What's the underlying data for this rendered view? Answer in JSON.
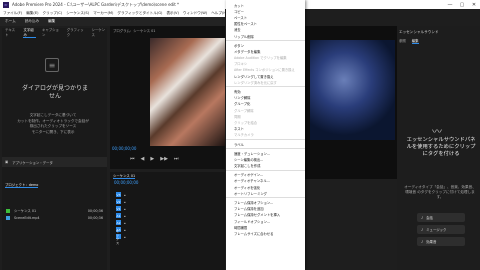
{
  "title_bar": {
    "app_logo": "Pr",
    "title": "Adobe Premiere Pro 2024 - C:\\ユーザー\\ALPC Garden\\デスクトップ\\demo\\scene edit *"
  },
  "window_controls": {
    "minimize": "—",
    "maximize": "▢",
    "close": "✕"
  },
  "menus": [
    "ファイル(F)",
    "編集(E)",
    "クリップ(C)",
    "シーケンス(S)",
    "マーカー(M)",
    "グラフィックとタイトル(G)",
    "表示(V)",
    "ウィンドウ(W)",
    "ヘルプ(H)"
  ],
  "workspace_tabs": [
    "ホーム",
    "読み込み",
    "編集"
  ],
  "left_panel": {
    "tabs": [
      "テキスト",
      "文字組み",
      "キャプション",
      "グラフィック",
      "シーケンス"
    ],
    "empty_icon": "≡",
    "heading": "ダイアログが見つかりません",
    "description": "文字起こしデータに基づいて\nカットを制作。オーディオトラックで会話が\n検出されたクリップをソース\nモニターに開き、下に表示"
  },
  "addon_bar": {
    "label": "アプリケーション・データ"
  },
  "program_monitor": {
    "title": "プログラム：シーケンス 01",
    "timecode": "00;00;00;00",
    "controls": [
      "⏮",
      "◀",
      "▶",
      "▶▶",
      "⏭"
    ]
  },
  "source_monitor": {
    "timecode": "00;00;36;17",
    "label": "1/2"
  },
  "essential_sound": {
    "title": "エッセンシャルサウンド",
    "tabs": [
      "参照",
      "編集"
    ],
    "wave_icon": "〰",
    "headline": "エッセンシャルサウンドパネルを使用するためにクリップにタグを付ける",
    "sub": "オーディオタイプ「会話」、音楽、効果音、環境音 のタグをクリップに付けて処理します。",
    "buttons": [
      "会話",
      "ミュージック",
      "効果音"
    ]
  },
  "project_panel": {
    "title": "プロジェクト：demo",
    "items": [
      {
        "name": "シーケンス 01",
        "color": "#3dbf3d",
        "dur": "00;00;36"
      },
      {
        "name": "SceneEdit.mp4",
        "color": "#3d9ee0",
        "dur": "00;00;36"
      }
    ]
  },
  "timeline": {
    "title": "シーケンス 01",
    "timecode": "00;00;00;00",
    "tracks": [
      "V3",
      "V2",
      "V1",
      "A1",
      "A2",
      "A3",
      "ミックス"
    ]
  },
  "context_menu": {
    "items": [
      {
        "label": "カット",
        "dis": false
      },
      {
        "label": "コピー",
        "dis": false
      },
      {
        "label": "ペースト",
        "dis": false
      },
      {
        "label": "属性をペースト",
        "dis": false
      },
      {
        "label": "消去",
        "dis": false
      },
      {
        "label": "リップル削除",
        "dis": false
      },
      {
        "sep": true
      },
      {
        "label": "ボタン",
        "dis": false
      },
      {
        "label": "メタデータを編集",
        "dis": false
      },
      {
        "label": "Adobe Audition でクリップを編集",
        "dis": true
      },
      {
        "label": "プロキシ",
        "dis": true
      },
      {
        "label": "After Effects コンポジションに置き換え",
        "dis": true
      },
      {
        "label": "レンダリングして置き換え",
        "dis": false
      },
      {
        "label": "レンダリング済みを元に戻す",
        "dis": true
      },
      {
        "sep": true
      },
      {
        "label": "有効",
        "dis": false
      },
      {
        "label": "リンク解除",
        "dis": false
      },
      {
        "label": "グループ化",
        "dis": false
      },
      {
        "label": "グループ解除",
        "dis": true
      },
      {
        "label": "同期",
        "dis": true
      },
      {
        "label": "クリップを結合",
        "dis": true
      },
      {
        "label": "ネスト",
        "dis": false
      },
      {
        "label": "マルチカメラ",
        "dis": true
      },
      {
        "sep": true
      },
      {
        "label": "ラベル",
        "dis": false
      },
      {
        "sep": true
      },
      {
        "label": "速度・デュレーション...",
        "dis": false
      },
      {
        "label": "シーン編集の検出...",
        "dis": false
      },
      {
        "label": "文字起こしを作成",
        "dis": false
      },
      {
        "sep": true
      },
      {
        "label": "オーディオゲイン...",
        "dis": false
      },
      {
        "label": "オーディオチャンネル...",
        "dis": false
      },
      {
        "label": "オーディオを強化",
        "dis": false
      },
      {
        "label": "オートリフレーミング",
        "dis": false
      },
      {
        "sep": true
      },
      {
        "label": "フレーム保持オプション...",
        "dis": false
      },
      {
        "label": "フレーム保持を追加",
        "dis": false
      },
      {
        "label": "フレーム保持セグメントを挿入",
        "dis": false
      },
      {
        "label": "フィールドオプション...",
        "dis": false
      },
      {
        "label": "時間補間",
        "dis": false
      },
      {
        "label": "フレームサイズに合わせる",
        "dis": false
      }
    ]
  },
  "colors": {
    "accent": "#2d8ceb"
  }
}
